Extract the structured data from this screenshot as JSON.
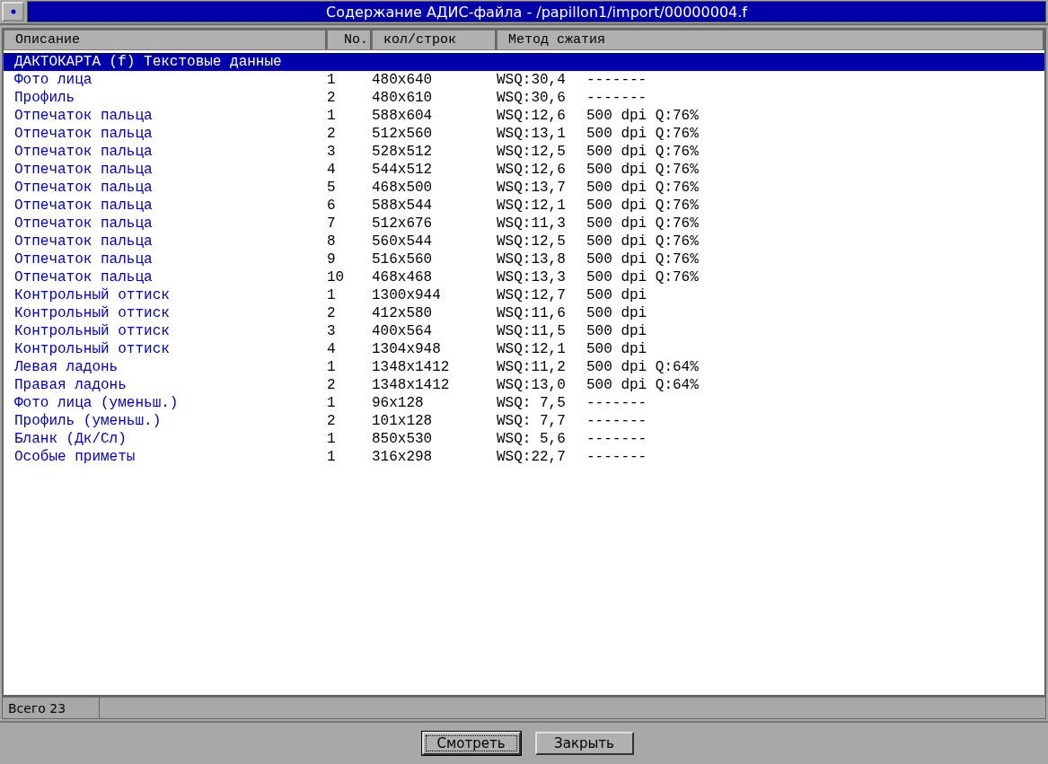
{
  "window": {
    "title": "Содержание АДИС-файла - /papillon1/import/00000004.f"
  },
  "table": {
    "columns": [
      "Описание",
      "No.",
      "кол/строк",
      "Метод сжатия"
    ],
    "rows": [
      {
        "selected": true,
        "cells": [
          "ДАКТОКАРТА (f) Текстовые данные"
        ]
      },
      {
        "selected": false,
        "cells": [
          "Фото лица",
          "1",
          "480x640",
          "WSQ:30,4",
          "-------"
        ]
      },
      {
        "selected": false,
        "cells": [
          "Профиль",
          "2",
          "480x610",
          "WSQ:30,6",
          "-------"
        ]
      },
      {
        "selected": false,
        "cells": [
          "Отпечаток пальца",
          "1",
          "588x604",
          "WSQ:12,6",
          "500 dpi Q:76%"
        ]
      },
      {
        "selected": false,
        "cells": [
          "Отпечаток пальца",
          "2",
          "512x560",
          "WSQ:13,1",
          "500 dpi Q:76%"
        ]
      },
      {
        "selected": false,
        "cells": [
          "Отпечаток пальца",
          "3",
          "528x512",
          "WSQ:12,5",
          "500 dpi Q:76%"
        ]
      },
      {
        "selected": false,
        "cells": [
          "Отпечаток пальца",
          "4",
          "544x512",
          "WSQ:12,6",
          "500 dpi Q:76%"
        ]
      },
      {
        "selected": false,
        "cells": [
          "Отпечаток пальца",
          "5",
          "468x500",
          "WSQ:13,7",
          "500 dpi Q:76%"
        ]
      },
      {
        "selected": false,
        "cells": [
          "Отпечаток пальца",
          "6",
          "588x544",
          "WSQ:12,1",
          "500 dpi Q:76%"
        ]
      },
      {
        "selected": false,
        "cells": [
          "Отпечаток пальца",
          "7",
          "512x676",
          "WSQ:11,3",
          "500 dpi Q:76%"
        ]
      },
      {
        "selected": false,
        "cells": [
          "Отпечаток пальца",
          "8",
          "560x544",
          "WSQ:12,5",
          "500 dpi Q:76%"
        ]
      },
      {
        "selected": false,
        "cells": [
          "Отпечаток пальца",
          "9",
          "516x560",
          "WSQ:13,8",
          "500 dpi Q:76%"
        ]
      },
      {
        "selected": false,
        "cells": [
          "Отпечаток пальца",
          "10",
          "468x468",
          "WSQ:13,3",
          "500 dpi Q:76%"
        ]
      },
      {
        "selected": false,
        "cells": [
          "Контрольный оттиск",
          "1",
          "1300x944",
          "WSQ:12,7",
          "500 dpi"
        ]
      },
      {
        "selected": false,
        "cells": [
          "Контрольный оттиск",
          "2",
          "412x580",
          "WSQ:11,6",
          "500 dpi"
        ]
      },
      {
        "selected": false,
        "cells": [
          "Контрольный оттиск",
          "3",
          "400x564",
          "WSQ:11,5",
          "500 dpi"
        ]
      },
      {
        "selected": false,
        "cells": [
          "Контрольный оттиск",
          "4",
          "1304x948",
          "WSQ:12,1",
          "500 dpi"
        ]
      },
      {
        "selected": false,
        "cells": [
          "Левая ладонь",
          "1",
          "1348x1412",
          "WSQ:11,2",
          "500 dpi Q:64%"
        ]
      },
      {
        "selected": false,
        "cells": [
          "Правая ладонь",
          "2",
          "1348x1412",
          "WSQ:13,0",
          "500 dpi Q:64%"
        ]
      },
      {
        "selected": false,
        "cells": [
          "Фото лица (уменьш.)",
          "1",
          "96x128",
          "WSQ: 7,5",
          "-------"
        ]
      },
      {
        "selected": false,
        "cells": [
          "Профиль (уменьш.)",
          "2",
          "101x128",
          "WSQ: 7,7",
          "-------"
        ]
      },
      {
        "selected": false,
        "cells": [
          "Бланк (Дк/Сл)",
          "1",
          "850x530",
          "WSQ: 5,6",
          "-------"
        ]
      },
      {
        "selected": false,
        "cells": [
          "Особые приметы",
          "1",
          "316x298",
          "WSQ:22,7",
          "-------"
        ]
      }
    ]
  },
  "status_bar": {
    "text": "Всего 23"
  },
  "buttons": [
    {
      "label": "Смотреть",
      "focused": true
    },
    {
      "label": "Закрыть",
      "focused": false
    }
  ]
}
